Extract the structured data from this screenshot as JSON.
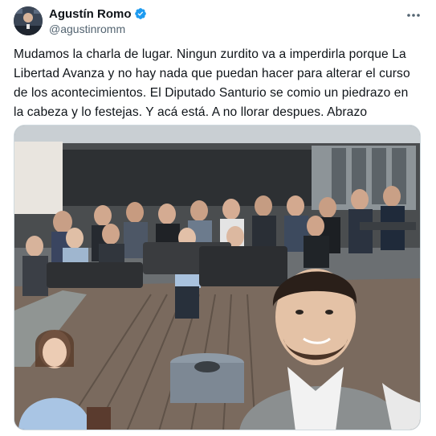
{
  "author": {
    "display_name": "Agustín Romo",
    "handle": "@agustinromm",
    "verified": true,
    "verified_color": "#1d9bf0"
  },
  "menu": {
    "icon": "more-horizontal-icon",
    "glyph": "•••"
  },
  "tweet": {
    "text": "Mudamos la charla de lugar. Ningun zurdito va a imperdirla porque La Libertad Avanza y no hay nada que puedan hacer para alterar el curso de los acontecimientos. El Diputado Santurio se comio un piedrazo en la cabeza y lo festejas. Y acá está. A no llorar despues. Abrazo"
  },
  "media": {
    "kind": "photo"
  },
  "colors": {
    "text_primary": "#0f1419",
    "text_secondary": "#536471",
    "border": "#cfd9de"
  }
}
